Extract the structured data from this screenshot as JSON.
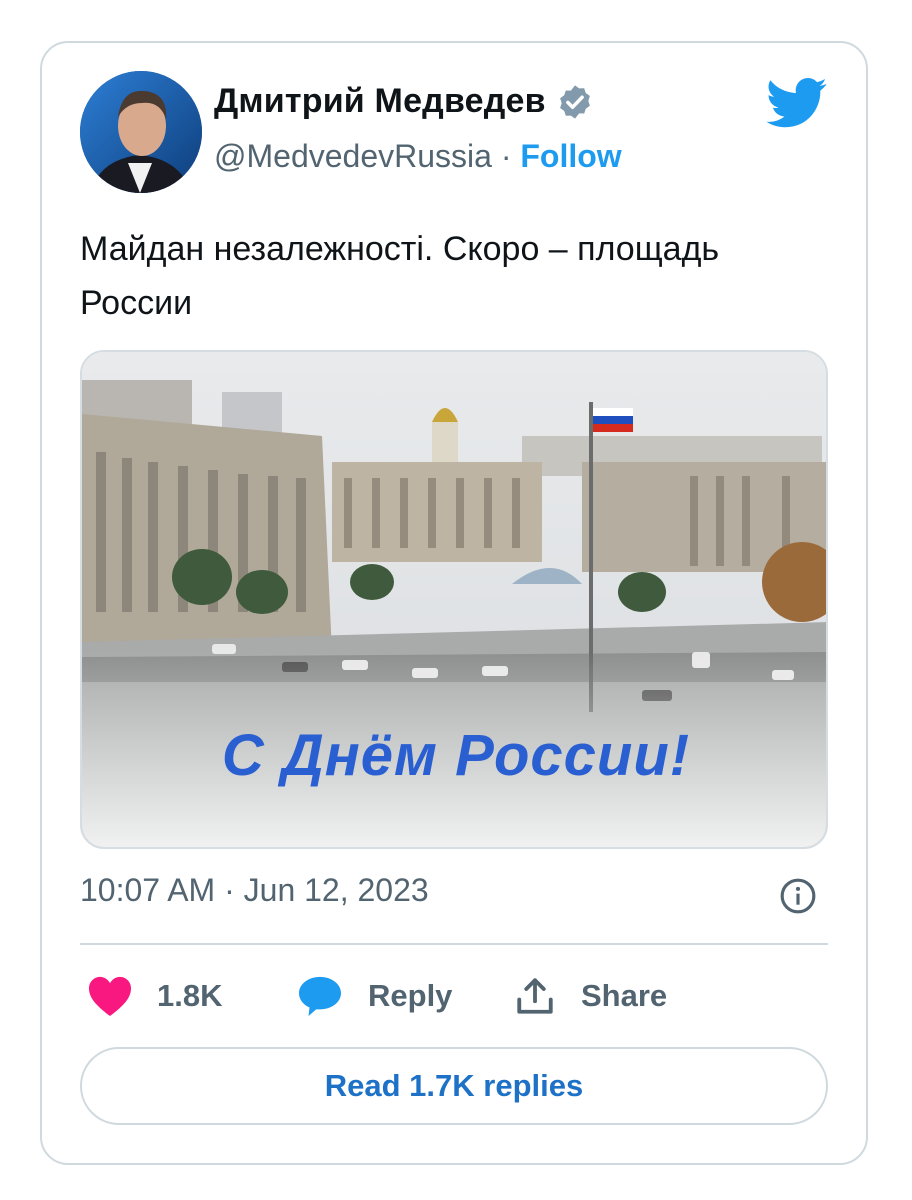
{
  "author": {
    "name": "Дмитрий Медведев",
    "handle": "@MedvedevRussia",
    "separator": "·",
    "follow_label": "Follow"
  },
  "tweet": {
    "text_line1": "Майдан незалежності. Скоро – площадь",
    "text_line2": "России",
    "media_banner": "С Днём России!",
    "timestamp": "10:07 AM · Jun 12, 2023"
  },
  "actions": {
    "like_count": "1.8K",
    "reply_label": "Reply",
    "share_label": "Share",
    "read_replies_label": "Read 1.7K replies"
  },
  "icons": [
    "verified-badge-icon",
    "twitter-bird-icon",
    "info-icon",
    "heart-icon",
    "reply-bubble-icon",
    "share-icon"
  ],
  "colors": {
    "accent": "#1d9bf0",
    "like": "#f91880",
    "text_secondary": "#536471",
    "border": "#cfd9de",
    "banner": "#2a5fd1"
  }
}
